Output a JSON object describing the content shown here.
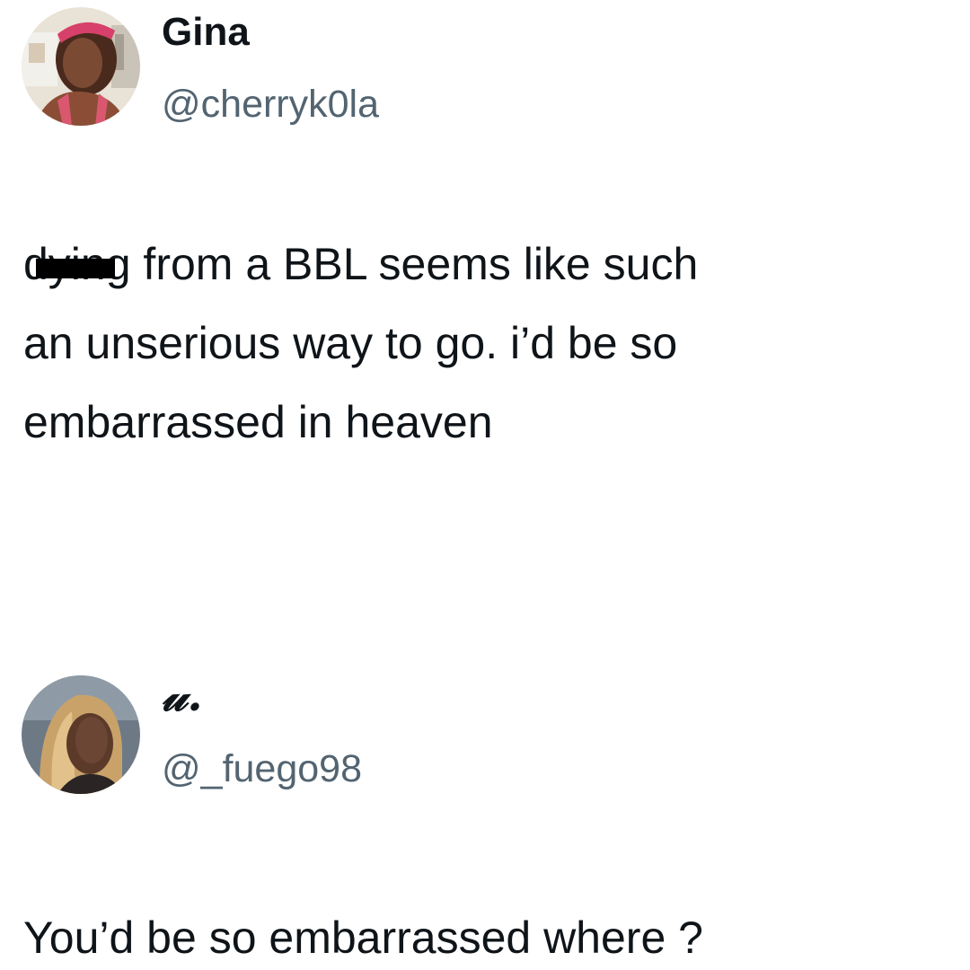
{
  "tweets": [
    {
      "display_name": "Gina",
      "handle": "@cherryk0la",
      "avatar_icon": "profile-photo",
      "text": {
        "censored_word": "dying",
        "line1_rest": " from a BBL seems like such",
        "line2": "an unserious way to go. i’d be so",
        "line3": "embarrassed in heaven"
      }
    },
    {
      "display_name": "𝓊.",
      "handle": "@_fuego98",
      "avatar_icon": "profile-photo",
      "text": {
        "line1": "You’d be so embarrassed where ?"
      }
    }
  ],
  "colors": {
    "text": "#0f1419",
    "handle": "#536471",
    "background": "#ffffff"
  }
}
